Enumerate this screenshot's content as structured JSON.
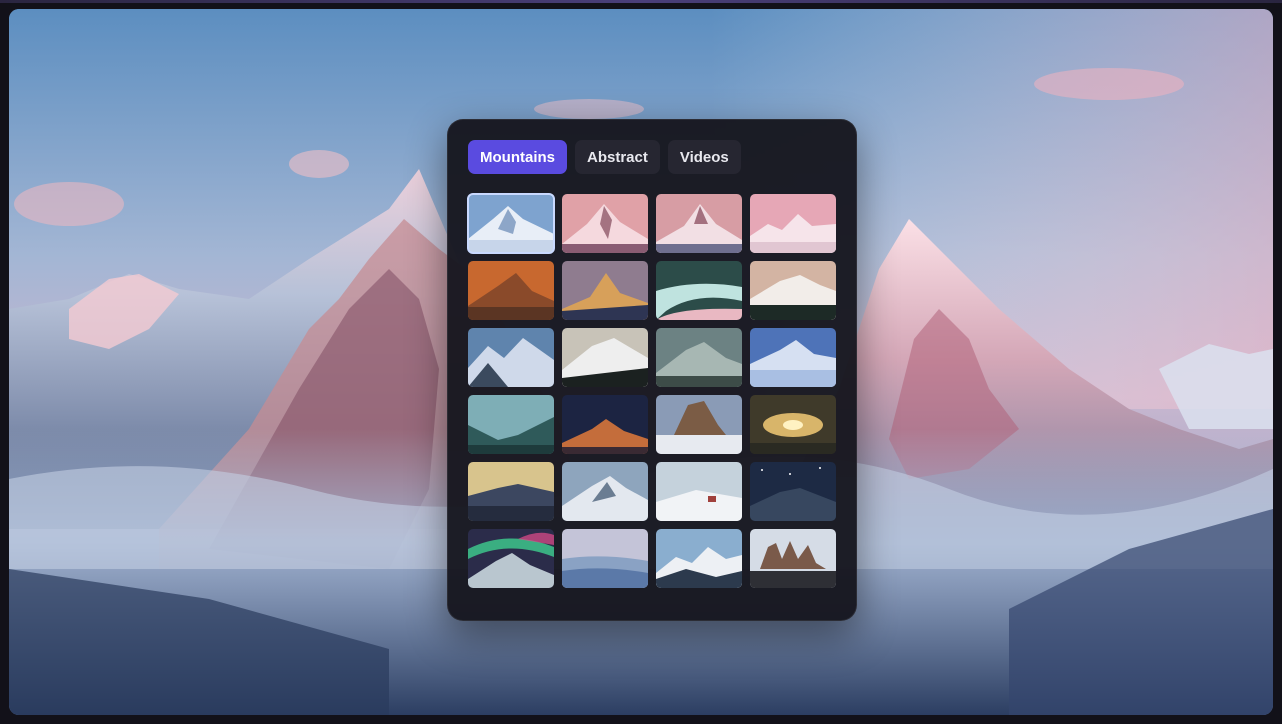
{
  "tabs": [
    {
      "label": "Mountains",
      "active": true
    },
    {
      "label": "Abstract",
      "active": false
    },
    {
      "label": "Videos",
      "active": false
    }
  ],
  "colors": {
    "accent": "#5a4be0",
    "panel": "#16161e",
    "tab": "#262631"
  },
  "thumbnails": [
    {
      "name": "thumb-mountain-blue-snow",
      "selected": true
    },
    {
      "name": "thumb-mountain-pink-peak"
    },
    {
      "name": "thumb-mountain-pink-peak-2"
    },
    {
      "name": "thumb-mountain-pink-range"
    },
    {
      "name": "thumb-mountain-orange-sunset"
    },
    {
      "name": "thumb-mountain-golden-peak"
    },
    {
      "name": "thumb-river-valley"
    },
    {
      "name": "thumb-mountain-forest-ridge"
    },
    {
      "name": "thumb-mountain-blue-range"
    },
    {
      "name": "thumb-mountain-snowy-slope"
    },
    {
      "name": "thumb-mountain-misty-green"
    },
    {
      "name": "thumb-mountain-clouds-blue"
    },
    {
      "name": "thumb-valley-teal-mist"
    },
    {
      "name": "thumb-mountain-night-sunset"
    },
    {
      "name": "thumb-mountain-rock-tower"
    },
    {
      "name": "thumb-sunburst-clouds"
    },
    {
      "name": "thumb-mountain-dusk-ridge"
    },
    {
      "name": "thumb-mountain-snow-cloudy"
    },
    {
      "name": "thumb-cabin-snow"
    },
    {
      "name": "thumb-mountain-starry-night"
    },
    {
      "name": "thumb-aurora-mountain"
    },
    {
      "name": "thumb-layered-blue-hills"
    },
    {
      "name": "thumb-mountain-snowy-peaks"
    },
    {
      "name": "thumb-rocky-towers-patagonia"
    }
  ]
}
